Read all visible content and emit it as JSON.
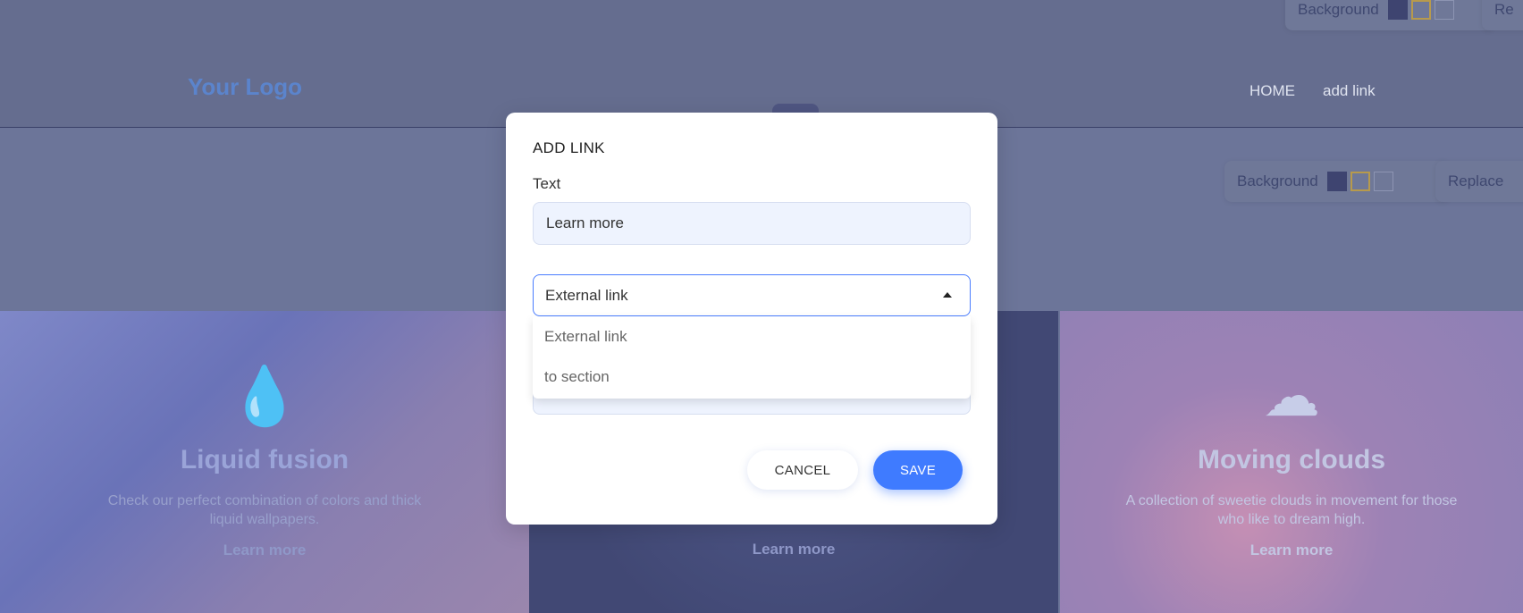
{
  "background": {
    "logo": "Your Logo",
    "nav": {
      "home": "HOME",
      "add_link": "add link"
    },
    "toolbar_top": {
      "background_label": "Background",
      "replace_label": "Re"
    },
    "toolbar_mid": {
      "background_label": "Background",
      "replace_label": "Replace"
    },
    "cards": [
      {
        "title": "Liquid fusion",
        "description": "Check our perfect combination of colors and thick liquid wallpapers.",
        "link": "Learn more",
        "icon": "droplet-icon"
      },
      {
        "title": "",
        "description": "",
        "link": "Learn more",
        "icon": ""
      },
      {
        "title": "Moving clouds",
        "description": "A collection of sweetie clouds in movement for those who like to dream high.",
        "link": "Learn more",
        "icon": "cloud-icon"
      }
    ]
  },
  "modal": {
    "title": "ADD LINK",
    "text_label": "Text",
    "text_value": "Learn more",
    "link_type": {
      "selected": "External link",
      "options": [
        "External link",
        "to section"
      ]
    },
    "cancel_label": "CANCEL",
    "save_label": "SAVE"
  },
  "colors": {
    "accent": "#3f7bff",
    "overlay": "#6c7599",
    "input_bg": "#eef3fe"
  }
}
